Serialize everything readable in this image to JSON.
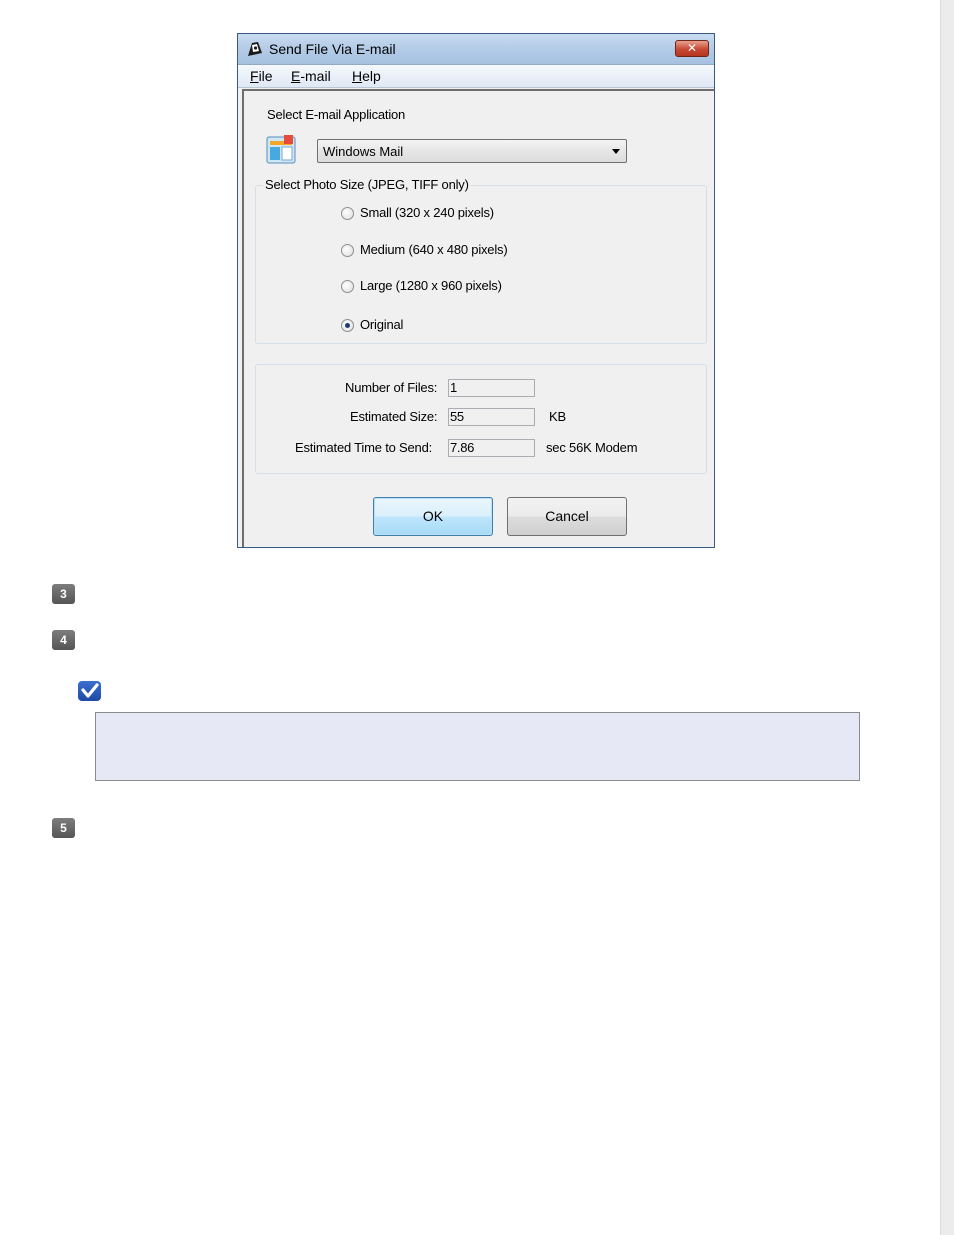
{
  "dialog": {
    "title": "Send File Via E-mail",
    "close_glyph": "✕",
    "menu": [
      {
        "accel": "F",
        "rest": "ile"
      },
      {
        "accel": "E",
        "rest": "-mail"
      },
      {
        "accel": "H",
        "rest": "elp"
      }
    ],
    "select_email_label": "Select E-mail Application",
    "email_app_selected": "Windows Mail",
    "photo_size_legend": "Select Photo Size (JPEG, TIFF only)",
    "photo_sizes": [
      {
        "label": "Small (320 x 240 pixels)",
        "checked": false
      },
      {
        "label": "Medium (640 x 480 pixels)",
        "checked": false
      },
      {
        "label": "Large (1280 x 960 pixels)",
        "checked": false
      },
      {
        "label": "Original",
        "checked": true
      }
    ],
    "info": {
      "num_files_label": "Number of Files:",
      "num_files_value": "1",
      "est_size_label": "Estimated Size:",
      "est_size_value": "55",
      "est_size_unit": "KB",
      "est_time_label": "Estimated Time to Send:",
      "est_time_value": "7.86",
      "est_time_unit": "sec 56K Modem"
    },
    "ok_label": "OK",
    "cancel_label": "Cancel"
  },
  "steps": [
    "3",
    "4",
    "5"
  ],
  "icons": {
    "app": "email-app-icon",
    "chooser": "mail-application-icon",
    "note": "note-checkmark-icon"
  },
  "colors": {
    "titlebar": "#b3cbe6",
    "close": "#c84a34",
    "note_bg": "#e6e8f6",
    "note_icon": "#1e4aa5",
    "step_badge": "#555555"
  }
}
